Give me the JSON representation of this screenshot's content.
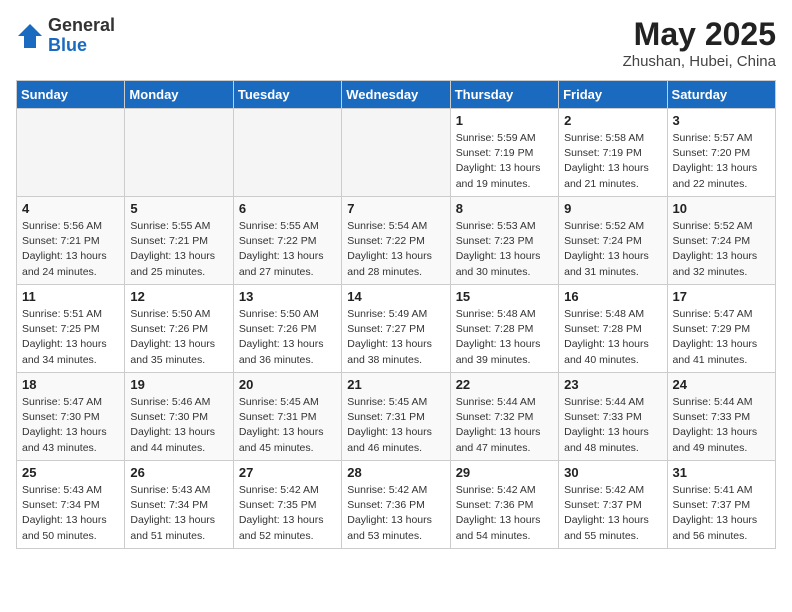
{
  "header": {
    "logo_general": "General",
    "logo_blue": "Blue",
    "title": "May 2025",
    "subtitle": "Zhushan, Hubei, China"
  },
  "days_of_week": [
    "Sunday",
    "Monday",
    "Tuesday",
    "Wednesday",
    "Thursday",
    "Friday",
    "Saturday"
  ],
  "weeks": [
    [
      {
        "day": "",
        "empty": true
      },
      {
        "day": "",
        "empty": true
      },
      {
        "day": "",
        "empty": true
      },
      {
        "day": "",
        "empty": true
      },
      {
        "day": "1",
        "sunrise": "5:59 AM",
        "sunset": "7:19 PM",
        "daylight": "13 hours and 19 minutes."
      },
      {
        "day": "2",
        "sunrise": "5:58 AM",
        "sunset": "7:19 PM",
        "daylight": "13 hours and 21 minutes."
      },
      {
        "day": "3",
        "sunrise": "5:57 AM",
        "sunset": "7:20 PM",
        "daylight": "13 hours and 22 minutes."
      }
    ],
    [
      {
        "day": "4",
        "sunrise": "5:56 AM",
        "sunset": "7:21 PM",
        "daylight": "13 hours and 24 minutes."
      },
      {
        "day": "5",
        "sunrise": "5:55 AM",
        "sunset": "7:21 PM",
        "daylight": "13 hours and 25 minutes."
      },
      {
        "day": "6",
        "sunrise": "5:55 AM",
        "sunset": "7:22 PM",
        "daylight": "13 hours and 27 minutes."
      },
      {
        "day": "7",
        "sunrise": "5:54 AM",
        "sunset": "7:22 PM",
        "daylight": "13 hours and 28 minutes."
      },
      {
        "day": "8",
        "sunrise": "5:53 AM",
        "sunset": "7:23 PM",
        "daylight": "13 hours and 30 minutes."
      },
      {
        "day": "9",
        "sunrise": "5:52 AM",
        "sunset": "7:24 PM",
        "daylight": "13 hours and 31 minutes."
      },
      {
        "day": "10",
        "sunrise": "5:52 AM",
        "sunset": "7:24 PM",
        "daylight": "13 hours and 32 minutes."
      }
    ],
    [
      {
        "day": "11",
        "sunrise": "5:51 AM",
        "sunset": "7:25 PM",
        "daylight": "13 hours and 34 minutes."
      },
      {
        "day": "12",
        "sunrise": "5:50 AM",
        "sunset": "7:26 PM",
        "daylight": "13 hours and 35 minutes."
      },
      {
        "day": "13",
        "sunrise": "5:50 AM",
        "sunset": "7:26 PM",
        "daylight": "13 hours and 36 minutes."
      },
      {
        "day": "14",
        "sunrise": "5:49 AM",
        "sunset": "7:27 PM",
        "daylight": "13 hours and 38 minutes."
      },
      {
        "day": "15",
        "sunrise": "5:48 AM",
        "sunset": "7:28 PM",
        "daylight": "13 hours and 39 minutes."
      },
      {
        "day": "16",
        "sunrise": "5:48 AM",
        "sunset": "7:28 PM",
        "daylight": "13 hours and 40 minutes."
      },
      {
        "day": "17",
        "sunrise": "5:47 AM",
        "sunset": "7:29 PM",
        "daylight": "13 hours and 41 minutes."
      }
    ],
    [
      {
        "day": "18",
        "sunrise": "5:47 AM",
        "sunset": "7:30 PM",
        "daylight": "13 hours and 43 minutes."
      },
      {
        "day": "19",
        "sunrise": "5:46 AM",
        "sunset": "7:30 PM",
        "daylight": "13 hours and 44 minutes."
      },
      {
        "day": "20",
        "sunrise": "5:45 AM",
        "sunset": "7:31 PM",
        "daylight": "13 hours and 45 minutes."
      },
      {
        "day": "21",
        "sunrise": "5:45 AM",
        "sunset": "7:31 PM",
        "daylight": "13 hours and 46 minutes."
      },
      {
        "day": "22",
        "sunrise": "5:44 AM",
        "sunset": "7:32 PM",
        "daylight": "13 hours and 47 minutes."
      },
      {
        "day": "23",
        "sunrise": "5:44 AM",
        "sunset": "7:33 PM",
        "daylight": "13 hours and 48 minutes."
      },
      {
        "day": "24",
        "sunrise": "5:44 AM",
        "sunset": "7:33 PM",
        "daylight": "13 hours and 49 minutes."
      }
    ],
    [
      {
        "day": "25",
        "sunrise": "5:43 AM",
        "sunset": "7:34 PM",
        "daylight": "13 hours and 50 minutes."
      },
      {
        "day": "26",
        "sunrise": "5:43 AM",
        "sunset": "7:34 PM",
        "daylight": "13 hours and 51 minutes."
      },
      {
        "day": "27",
        "sunrise": "5:42 AM",
        "sunset": "7:35 PM",
        "daylight": "13 hours and 52 minutes."
      },
      {
        "day": "28",
        "sunrise": "5:42 AM",
        "sunset": "7:36 PM",
        "daylight": "13 hours and 53 minutes."
      },
      {
        "day": "29",
        "sunrise": "5:42 AM",
        "sunset": "7:36 PM",
        "daylight": "13 hours and 54 minutes."
      },
      {
        "day": "30",
        "sunrise": "5:42 AM",
        "sunset": "7:37 PM",
        "daylight": "13 hours and 55 minutes."
      },
      {
        "day": "31",
        "sunrise": "5:41 AM",
        "sunset": "7:37 PM",
        "daylight": "13 hours and 56 minutes."
      }
    ]
  ],
  "labels": {
    "sunrise_prefix": "Sunrise: ",
    "sunset_prefix": "Sunset: ",
    "daylight_prefix": "Daylight: "
  }
}
